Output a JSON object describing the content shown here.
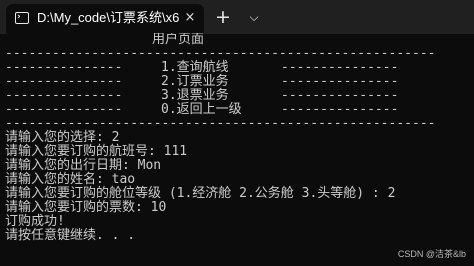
{
  "window": {
    "tab_title": "D:\\My_code\\订票系统\\x6",
    "tab_icon": "terminal-icon",
    "close_icon": "×",
    "new_tab_icon": "+",
    "dropdown_icon": "⌵"
  },
  "terminal": {
    "header": "用户页面",
    "separator": "-------------------------------------------------------",
    "menu_dashes": "---------------",
    "menu_items": [
      "1.查询航线",
      "2.订票业务",
      "3.退票业务",
      "0.返回上一级"
    ],
    "session": [
      "请输入您的选择: 2",
      "请输入您要订购的航班号: 111",
      "请输入您的出行日期: Mon",
      "请输入您的姓名: tao",
      "请输入您要订购的舱位等级 (1.经济舱 2.公务舱 3.头等舱) : 2",
      "请输入您要订购的票数: 10",
      "订购成功!",
      "请按任意键继续. . ."
    ]
  },
  "watermark": "CSDN @洁茶&lb",
  "colors": {
    "terminal_bg": "#0c0c0c",
    "titlebar_bg": "#202020",
    "text": "#cccccc"
  }
}
